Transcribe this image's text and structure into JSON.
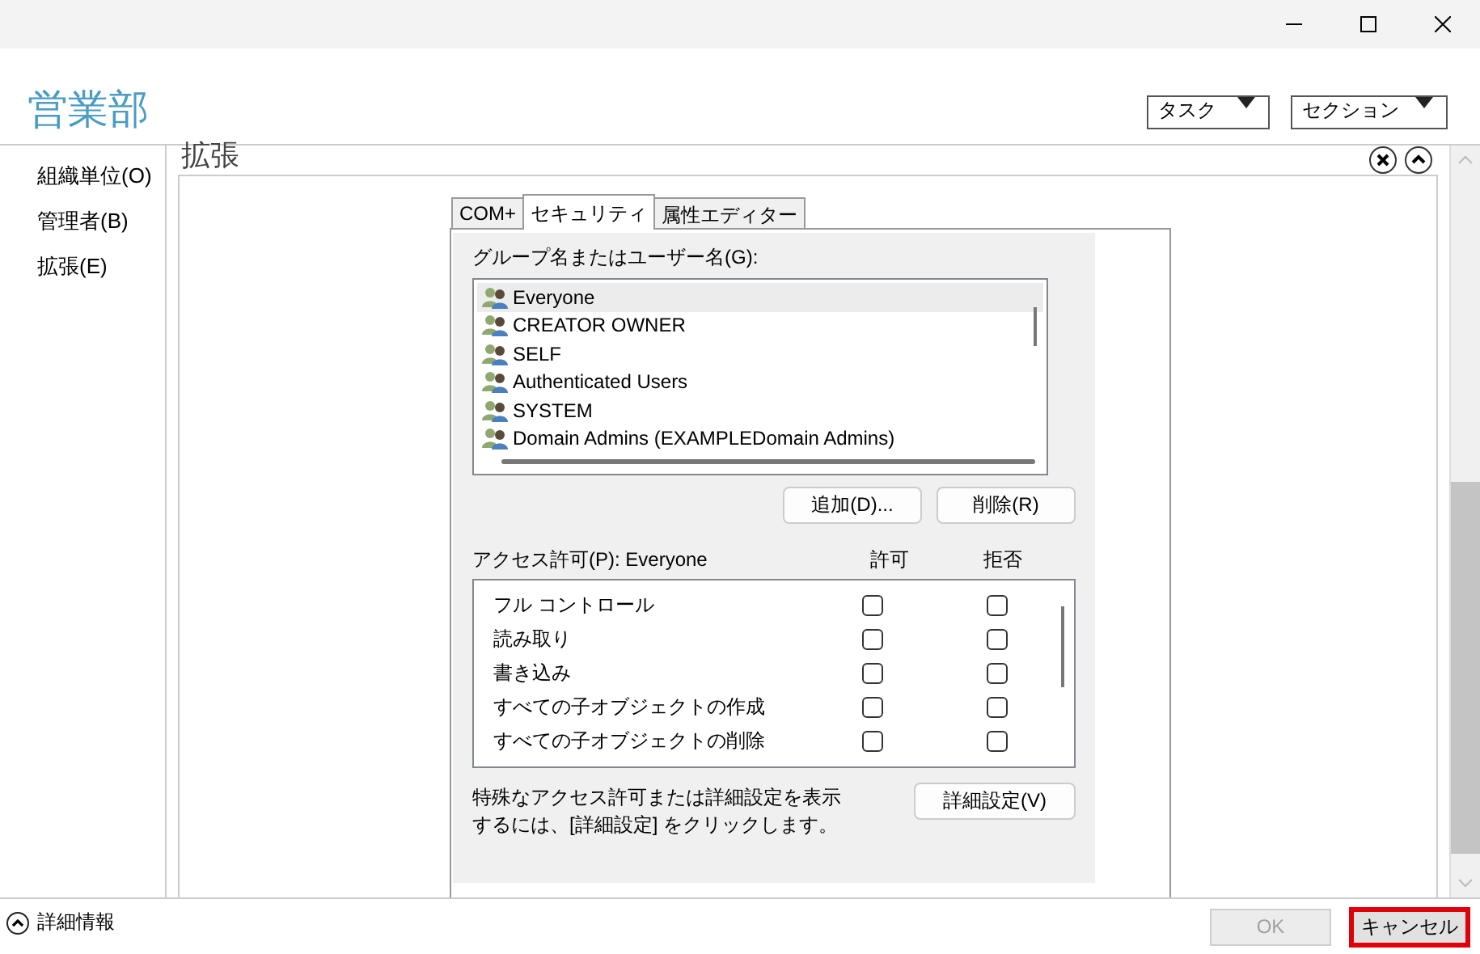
{
  "header": {
    "title": "営業部",
    "menus": [
      {
        "label": "タスク"
      },
      {
        "label": "セクション"
      }
    ]
  },
  "nav": {
    "items": [
      {
        "label": "組織単位(O)"
      },
      {
        "label": "管理者(B)"
      },
      {
        "label": "拡張(E)"
      }
    ]
  },
  "section": {
    "heading": "拡張"
  },
  "dialog": {
    "tabs": [
      {
        "label": "COM+",
        "selected": false
      },
      {
        "label": "セキュリティ",
        "selected": true
      },
      {
        "label": "属性エディター",
        "selected": false
      }
    ],
    "users_label": "グループ名またはユーザー名(G):",
    "users": [
      {
        "name": "Everyone",
        "selected": true
      },
      {
        "name": "CREATOR OWNER",
        "selected": false
      },
      {
        "name": "SELF",
        "selected": false
      },
      {
        "name": "Authenticated Users",
        "selected": false
      },
      {
        "name": "SYSTEM",
        "selected": false
      },
      {
        "name": "Domain Admins (EXAMPLEDomain Admins)",
        "selected": false
      }
    ],
    "user_buttons": [
      {
        "label": "追加(D)..."
      },
      {
        "label": "削除(R)"
      }
    ],
    "permissions_label": "アクセス許可(P): Everyone",
    "permission_columns": [
      "許可",
      "拒否"
    ],
    "permissions": [
      {
        "name": "フル コントロール",
        "allow": false,
        "deny": false
      },
      {
        "name": "読み取り",
        "allow": false,
        "deny": false
      },
      {
        "name": "書き込み",
        "allow": false,
        "deny": false
      },
      {
        "name": "すべての子オブジェクトの作成",
        "allow": false,
        "deny": false
      },
      {
        "name": "すべての子オブジェクトの削除",
        "allow": false,
        "deny": false
      }
    ],
    "advanced_note": "特殊なアクセス許可または詳細設定を表示するには、[詳細設定] をクリックします。",
    "advanced_button": {
      "label": "詳細設定(V)"
    }
  },
  "footer": {
    "details": "詳細情報",
    "buttons": [
      {
        "label": "OK",
        "disabled": true,
        "highlighted": false
      },
      {
        "label": "キャンセル",
        "disabled": false,
        "highlighted": true
      }
    ]
  }
}
